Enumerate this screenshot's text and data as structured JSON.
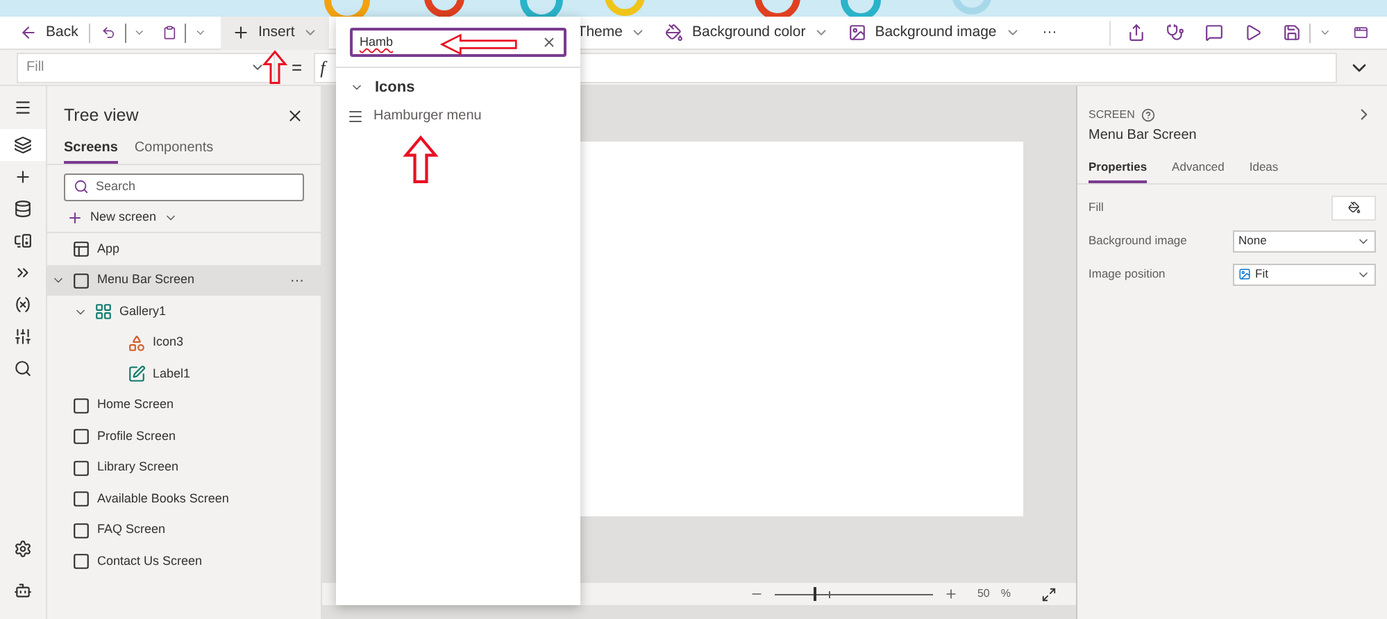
{
  "toolbar": {
    "back": "Back",
    "insert": "Insert",
    "theme": "Theme",
    "background_color": "Background color",
    "background_image": "Background image",
    "more": "···"
  },
  "formula_bar": {
    "property": "Fill",
    "equals": "=",
    "fx": "f"
  },
  "left_rail": [
    {
      "kind": "tree",
      "selected": true
    },
    {
      "kind": "insert",
      "selected": false
    },
    {
      "kind": "data",
      "selected": false
    },
    {
      "kind": "media",
      "selected": false
    },
    {
      "kind": "automate",
      "selected": false
    },
    {
      "kind": "variables",
      "selected": false
    },
    {
      "kind": "tools",
      "selected": false
    },
    {
      "kind": "search",
      "selected": false
    }
  ],
  "tree_view": {
    "title": "Tree view",
    "tabs": [
      {
        "label": "Screens",
        "selected": true
      },
      {
        "label": "Components",
        "selected": false
      }
    ],
    "search": {
      "placeholder": "Search"
    },
    "new_screen": "New screen",
    "items": [
      {
        "label": "App",
        "kind": "app",
        "selected": false
      },
      {
        "label": "Menu Bar Screen",
        "kind": "screen",
        "selected": true,
        "expanded": true,
        "more": "···",
        "children": [
          {
            "label": "Gallery1",
            "kind": "gallery",
            "selected": false,
            "expanded": true,
            "children": [
              {
                "label": "Icon3",
                "kind": "icon",
                "selected": false
              },
              {
                "label": "Label1",
                "kind": "label",
                "selected": false
              }
            ]
          }
        ]
      },
      {
        "label": "Home Screen",
        "kind": "screen",
        "selected": false
      },
      {
        "label": "Profile Screen",
        "kind": "screen",
        "selected": false
      },
      {
        "label": "Library Screen",
        "kind": "screen",
        "selected": false
      },
      {
        "label": "Available Books Screen",
        "kind": "screen",
        "selected": false
      },
      {
        "label": "FAQ Screen",
        "kind": "screen",
        "selected": false
      },
      {
        "label": "Contact Us Screen",
        "kind": "screen",
        "selected": false
      }
    ]
  },
  "insert_popup": {
    "search_value": "Hamb",
    "group": "Icons",
    "items": [
      "Hamburger menu"
    ]
  },
  "zoom": {
    "level": 0.25,
    "value": "50",
    "unit": "%"
  },
  "properties": {
    "heading": "SCREEN",
    "name": "Menu Bar Screen",
    "tabs": [
      {
        "label": "Properties",
        "selected": true
      },
      {
        "label": "Advanced",
        "selected": false
      },
      {
        "label": "Ideas",
        "selected": false
      }
    ],
    "rows": [
      {
        "label": "Fill",
        "kind": "color"
      },
      {
        "label": "Background image",
        "kind": "select",
        "value": "None"
      },
      {
        "label": "Image position",
        "kind": "select",
        "value": "Fit",
        "image_icon": true
      }
    ]
  }
}
